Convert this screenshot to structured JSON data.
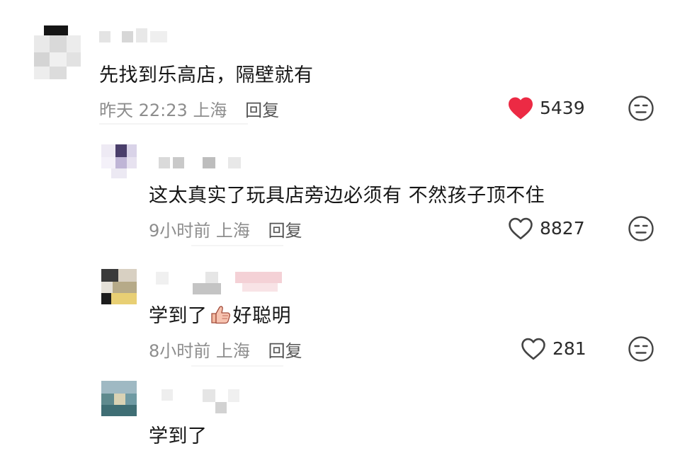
{
  "comments": [
    {
      "text": "先找到乐高店，隔壁就有",
      "time": "昨天 22:23",
      "location": "上海",
      "reply_label": "回复",
      "likes": "5439",
      "liked": true,
      "icons": {
        "like": "heart-filled-icon",
        "reaction": "meh-face-icon"
      }
    },
    {
      "text": "这太真实了玩具店旁边必须有 不然孩子顶不住",
      "time": "9小时前",
      "location": "上海",
      "reply_label": "回复",
      "likes": "8827",
      "liked": false,
      "icons": {
        "like": "heart-outline-icon",
        "reaction": "meh-face-icon"
      }
    },
    {
      "text_before": "学到了",
      "emoji": "thumbs-up-emoji",
      "text_after": "好聪明",
      "time": "8小时前",
      "location": "上海",
      "reply_label": "回复",
      "likes": "281",
      "liked": false,
      "icons": {
        "like": "heart-outline-icon",
        "reaction": "meh-face-icon"
      }
    },
    {
      "text": "学到了"
    }
  ],
  "colors": {
    "liked_heart": "#ec2a44",
    "meta_text": "#8d8d8d",
    "icon_gray": "#444444"
  }
}
